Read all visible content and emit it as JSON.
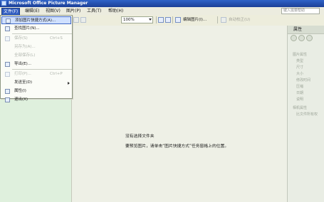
{
  "window": {
    "title": "Microsoft Office Picture Manager"
  },
  "menubar": {
    "items": [
      {
        "label": "文件(F)"
      },
      {
        "label": "编辑(E)"
      },
      {
        "label": "视图(V)"
      },
      {
        "label": "图片(P)"
      },
      {
        "label": "工具(T)"
      },
      {
        "label": "帮助(H)"
      }
    ],
    "help_placeholder": "键入需要帮助"
  },
  "toolbar": {
    "zoom": "100%",
    "edit_pictures": "编辑图片(I)...",
    "auto_correct": "自动校正(U)"
  },
  "file_menu": {
    "items": [
      {
        "label": "添加图片快捷方式(A)...",
        "shortcut": "",
        "disabled": false,
        "active": true
      },
      {
        "label": "查找图片(N)...",
        "shortcut": "",
        "disabled": false
      },
      {
        "label": "保存(S)",
        "shortcut": "Ctrl+S",
        "disabled": true
      },
      {
        "label": "另存为(A)...",
        "shortcut": "",
        "disabled": true
      },
      {
        "label": "全部保存(L)",
        "shortcut": "",
        "disabled": true
      },
      {
        "label": "导出(E)...",
        "shortcut": "",
        "disabled": false
      },
      {
        "label": "打印(P)...",
        "shortcut": "Ctrl+P",
        "disabled": true
      },
      {
        "label": "发送至(D)",
        "shortcut": "",
        "disabled": false,
        "submenu": true
      },
      {
        "label": "属性(I)",
        "shortcut": "",
        "disabled": false
      },
      {
        "label": "退出(X)",
        "shortcut": "",
        "disabled": false
      }
    ]
  },
  "main": {
    "empty_title": "没有选择文件夹",
    "hint": "要预览图片，请单击“图片快捷方式”任务窗格上的位置。"
  },
  "right_panel": {
    "title": "属性",
    "sections": [
      {
        "heading": "图片属性",
        "items": [
          "类型",
          "尺寸",
          "大小",
          "修改时间",
          "压缩",
          "日期",
          "说明"
        ]
      },
      {
        "heading": "相机属性",
        "items": [
          "比文件所有权"
        ]
      }
    ]
  },
  "colors": {
    "titlebar": "#2f63c8",
    "active_menu": "#315dc1",
    "highlight_item": "#cfe0ff"
  }
}
